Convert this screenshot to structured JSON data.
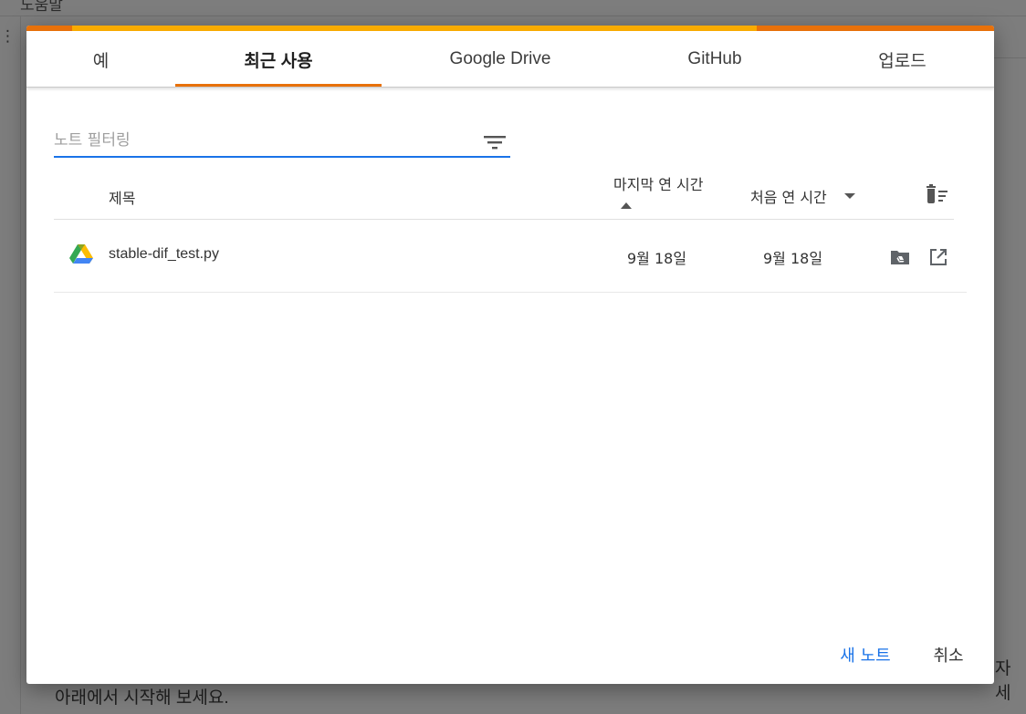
{
  "background": {
    "menu_text": "도움말",
    "side_text": "⋮",
    "bottom_text": "아래에서 시작해 보세요.",
    "right_text": "자세"
  },
  "dialog": {
    "tabs": [
      {
        "label": "예",
        "active": false
      },
      {
        "label": "최근 사용",
        "active": true
      },
      {
        "label": "Google Drive",
        "active": false
      },
      {
        "label": "GitHub",
        "active": false
      },
      {
        "label": "업로드",
        "active": false
      }
    ],
    "filter": {
      "placeholder": "노트 필터링",
      "value": ""
    },
    "table": {
      "headers": {
        "title": "제목",
        "last_opened": "마지막 연 시간",
        "first_opened": "처음 연 시간"
      },
      "rows": [
        {
          "icon": "google-drive-icon",
          "name": "stable-dif_test.py",
          "last_opened": "9월 18일",
          "first_opened": "9월 18일"
        }
      ]
    },
    "footer": {
      "new_label": "새 노트",
      "cancel_label": "취소"
    }
  },
  "colors": {
    "accent_orange": "#e8710a",
    "accent_yellow": "#f9ab00",
    "link_blue": "#1a73e8"
  }
}
